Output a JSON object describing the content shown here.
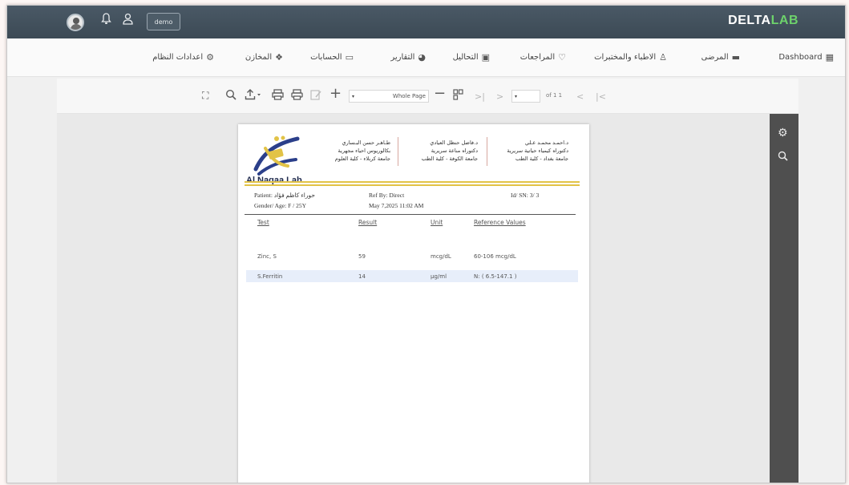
{
  "header": {
    "username": "demo",
    "brand_primary": "DELTA",
    "brand_accent": "LAB",
    "brand_accent_color": "#6dd26b",
    "icons": [
      "avatar",
      "bell-icon",
      "user-icon"
    ]
  },
  "nav": {
    "items": [
      {
        "label": "Dashboard",
        "icon": "dashboard-icon"
      },
      {
        "label": "المرضى",
        "icon": "bed-icon"
      },
      {
        "label": "الاطباء والمختبرات",
        "icon": "doctor-icon"
      },
      {
        "label": "المراجعات",
        "icon": "heartbeat-icon"
      },
      {
        "label": "التحاليل",
        "icon": "medkit-icon"
      },
      {
        "label": "التقارير",
        "icon": "pie-chart-icon"
      },
      {
        "label": "الحسابات",
        "icon": "money-icon"
      },
      {
        "label": "المخازن",
        "icon": "cubes-icon"
      },
      {
        "label": "اعدادات النظام",
        "icon": "gear-icon"
      }
    ]
  },
  "pdf_toolbar": {
    "zoom": "Whole Page",
    "page_info": "of 1 1",
    "page_number": "",
    "icons": [
      "fullscreen-icon",
      "search-icon",
      "export-icon",
      "print-layout-icon",
      "print-icon",
      "edit-icon",
      "zoom-in-icon",
      "zoom-out-icon",
      "multi-page-icon",
      "last-page-icon",
      "next-page-icon",
      "previous-page-icon",
      "first-page-icon"
    ]
  },
  "side_panel": {
    "icons": [
      "gear-icon",
      "search-icon"
    ]
  },
  "report": {
    "lab_name": "Al Naqaa Lab",
    "doctors": [
      {
        "name": "طـاهـر حسن البـساري",
        "degree": "بكالوريوس احياء مجهرية",
        "affiliation": "جامعة كربلاء - كلية العلوم"
      },
      {
        "name": "د.فاضل حنظل العيادي",
        "degree": "دكتوراه مناعة سريرية",
        "affiliation": "جامعة الكوفة - كلية الطب"
      },
      {
        "name": "د.احمـد محمـد عـلي",
        "degree": "دكتوراه كيمياء حياتية سريرية",
        "affiliation": "جامعة بغداد - كلية الطب"
      }
    ],
    "patient_label": "Patient:",
    "patient_name": "حوراء كاظم فؤاد",
    "gender_age": "Gender/ Age:  F / 25Y",
    "ref_by": "Ref By: Direct",
    "date": "May 7,2025 11:02 AM",
    "id_sn": "Id/ SN: 3/ 3",
    "columns": [
      "Test",
      "Result",
      "Unit",
      "Reference Values"
    ],
    "rows": [
      {
        "test": "Zinc, S",
        "result": "59",
        "unit": "mcg/dL",
        "reference": "60-106 mcg/dL"
      },
      {
        "test": "S.Ferritin",
        "result": "14",
        "unit": "µg/ml",
        "reference": "N: ( 6.5-147.1 )"
      }
    ]
  }
}
